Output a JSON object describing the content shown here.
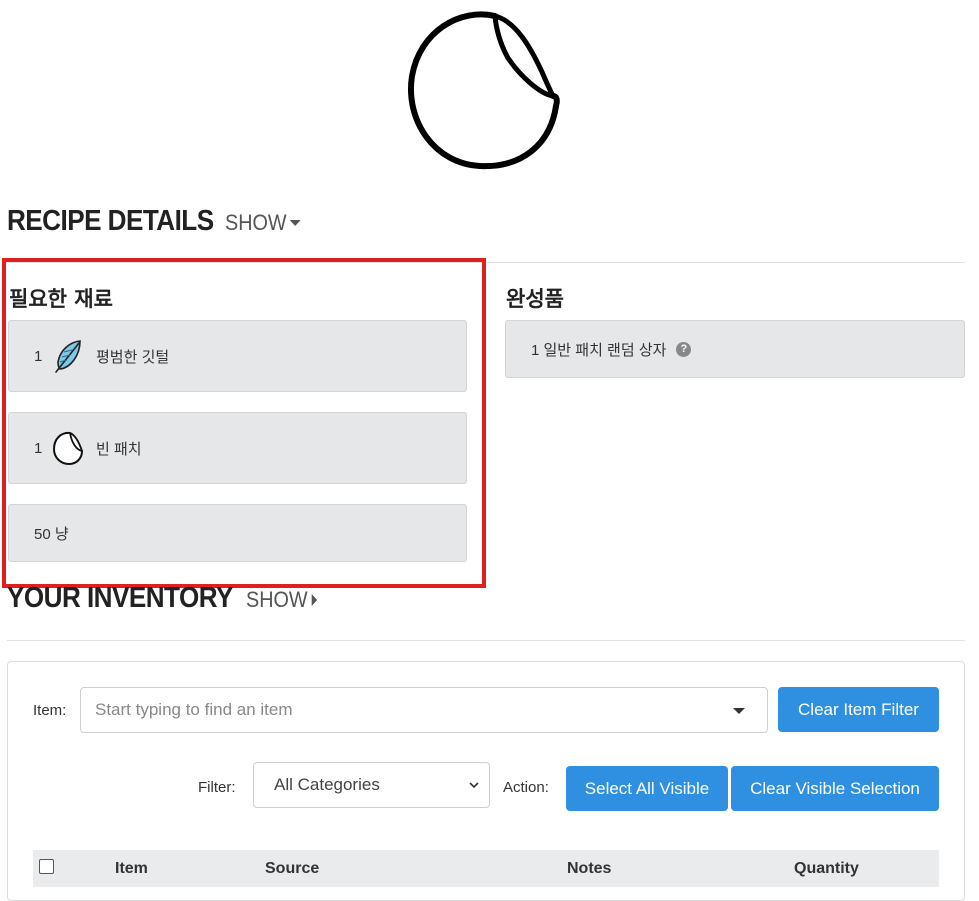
{
  "recipe": {
    "title": "RECIPE DETAILS",
    "toggle": "SHOW",
    "ingredients_title": "필요한 재료",
    "ingredients": [
      {
        "qty": "1",
        "name": "평범한 깃털",
        "icon": "feather-icon"
      },
      {
        "qty": "1",
        "name": "빈 패치",
        "icon": "patch-icon"
      }
    ],
    "currency": "50 냥",
    "result_title": "완성품",
    "result": {
      "text": "1 일반 패치 랜덤 상자",
      "help": "?"
    }
  },
  "inventory": {
    "title": "YOUR INVENTORY",
    "toggle": "SHOW",
    "item_label": "Item:",
    "item_placeholder": "Start typing to find an item",
    "clear_item_filter": "Clear Item Filter",
    "filter_label": "Filter:",
    "filter_value": "All Categories",
    "action_label": "Action:",
    "select_all_visible": "Select All Visible",
    "clear_visible_selection": "Clear Visible Selection",
    "columns": [
      "Item",
      "Source",
      "Notes",
      "Quantity"
    ]
  },
  "colors": {
    "accent": "#2f8fe0",
    "highlight": "#e0201e",
    "card": "#e6e7e8"
  }
}
